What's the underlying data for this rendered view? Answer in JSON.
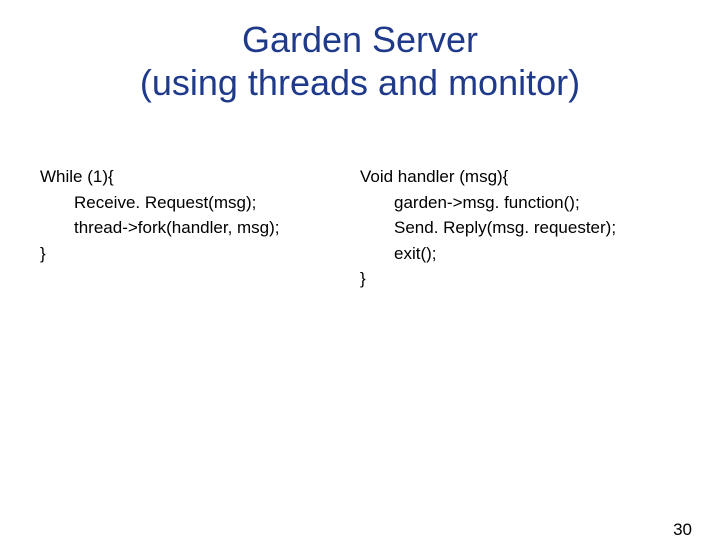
{
  "title_line1": "Garden Server",
  "title_line2": "(using threads and monitor)",
  "left_code": {
    "line1": "While (1){",
    "line2": "Receive. Request(msg);",
    "line3": "thread->fork(handler, msg);",
    "line4": "}"
  },
  "right_code": {
    "line1": "Void handler (msg){",
    "line2": "garden->msg. function();",
    "line3": "Send. Reply(msg. requester);",
    "line4": "exit();",
    "line5": "}"
  },
  "page_number": "30"
}
